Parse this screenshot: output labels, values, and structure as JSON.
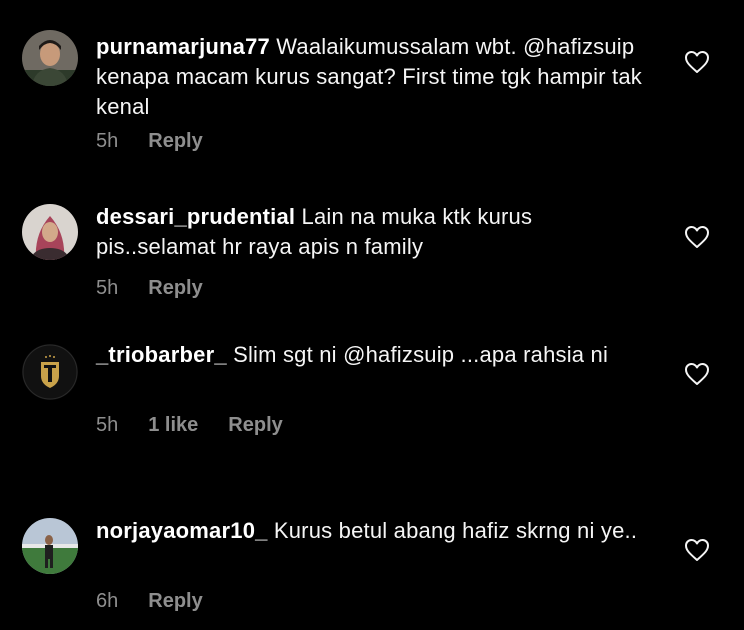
{
  "comments": [
    {
      "username": "purnamarjuna77",
      "text": "Waalaikumussalam wbt. @hafizsuip kenapa macam kurus sangat? First time tgk hampir tak kenal",
      "time": "5h",
      "likes": "",
      "reply": "Reply",
      "avatar_icon": "avatar-man"
    },
    {
      "username": "dessari_prudential",
      "text": "Lain na muka ktk kurus pis..selamat hr raya apis n family",
      "time": "5h",
      "likes": "",
      "reply": "Reply",
      "avatar_icon": "avatar-woman-hijab"
    },
    {
      "username": "_triobarber_",
      "text": "Slim sgt ni @hafizsuip ...apa rahsia ni",
      "time": "5h",
      "likes": "1 like",
      "reply": "Reply",
      "avatar_icon": "barber-logo"
    },
    {
      "username": "norjayaomar10_",
      "text": "Kurus betul abang hafiz skrng ni ye..",
      "time": "6h",
      "likes": "",
      "reply": "Reply",
      "avatar_icon": "avatar-field"
    }
  ],
  "colors": {
    "background": "#000000",
    "text": "#f5f5f5",
    "muted": "#8e8e8e"
  },
  "icons": {
    "like": "heart-outline-icon"
  }
}
